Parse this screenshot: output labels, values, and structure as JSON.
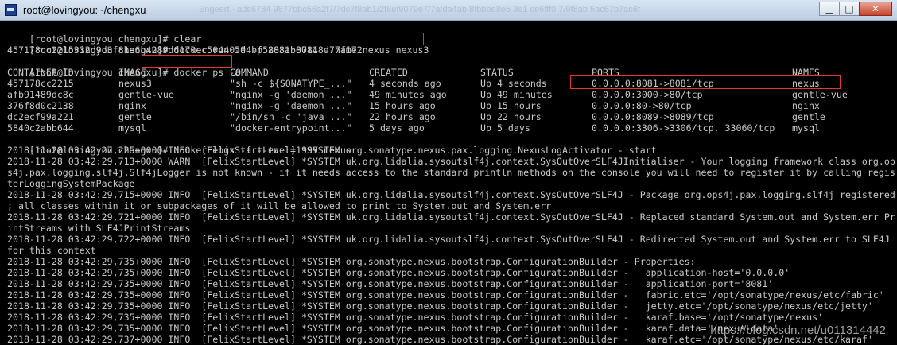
{
  "window": {
    "title": "root@lovingyou:~/chengxu",
    "blurred_text": "Engeert · ads6784 9877bbc56a2f7/7dc7f8ab1/2f8ef9079e7/7a/da4ab 8fbbbe8e5 3e1 ce6fff0 7/9f8ab 5ac67b7ac6f",
    "minimize_symbol": "▁",
    "maximize_symbol": "□",
    "close_symbol": "✕"
  },
  "terminal": {
    "prompt": "[root@lovingyou chengxu]#",
    "cmd_clear": " clear",
    "cmd_run": " docker run -d -p 8081:8081 --name nexus nexus3",
    "run_output": "457178cc2215332d9d3f81a6b4289d6170ec50440594bf5283ab07148d77f172",
    "cmd_ps": " docker ps -a",
    "cmd_logs": " docker logs -f --tail=1999 nexus",
    "ps_table": {
      "headers": [
        "CONTAINER ID",
        "IMAGE",
        "COMMAND",
        "CREATED",
        "STATUS",
        "PORTS",
        "NAMES"
      ],
      "rows": [
        [
          "457178cc2215",
          "nexus3",
          "\"sh -c ${SONATYPE_...\"",
          "4 seconds ago",
          "Up 4 seconds",
          "0.0.0.0:8081->8081/tcp",
          "nexus"
        ],
        [
          "afb91489dc8c",
          "gentle-vue",
          "\"nginx -g 'daemon ...\"",
          "49 minutes ago",
          "Up 49 minutes",
          "0.0.0.0:3000->80/tcp",
          "gentle-vue"
        ],
        [
          "376f8d0c2138",
          "nginx",
          "\"nginx -g 'daemon ...\"",
          "15 hours ago",
          "Up 15 hours",
          "0.0.0.0:80->80/tcp",
          "nginx"
        ],
        [
          "dc2ecf99a221",
          "gentle",
          "\"/bin/sh -c 'java ...\"",
          "22 hours ago",
          "Up 22 hours",
          "0.0.0.0:8089->8089/tcp",
          "gentle"
        ],
        [
          "5840c2abb644",
          "mysql",
          "\"docker-entrypoint...\"",
          "5 days ago",
          "Up 5 days",
          "0.0.0.0:3306->3306/tcp, 33060/tcp",
          "mysql"
        ]
      ]
    },
    "log_lines": [
      "2018-11-28 03:42:27,225+0000 INFO  [FelixStartLevel] *SYSTEM org.sonatype.nexus.pax.logging.NexusLogActivator - start",
      "2018-11-28 03:42:29,713+0000 WARN  [FelixStartLevel] *SYSTEM uk.org.lidalia.sysoutslf4j.context.SysOutOverSLF4JInitialiser - Your logging framework class org.op",
      "s4j.pax.logging.slf4j.Slf4jLogger is not known - if it needs access to the standard println methods on the console you will need to register it by calling regis",
      "terLoggingSystemPackage",
      "2018-11-28 03:42:29,715+0000 INFO  [FelixStartLevel] *SYSTEM uk.org.lidalia.sysoutslf4j.context.SysOutOverSLF4J - Package org.ops4j.pax.logging.slf4j registered",
      "; all classes within it or subpackages of it will be allowed to print to System.out and System.err",
      "2018-11-28 03:42:29,721+0000 INFO  [FelixStartLevel] *SYSTEM uk.org.lidalia.sysoutslf4j.context.SysOutOverSLF4J - Replaced standard System.out and System.err Pr",
      "intStreams with SLF4JPrintStreams",
      "2018-11-28 03:42:29,722+0000 INFO  [FelixStartLevel] *SYSTEM uk.org.lidalia.sysoutslf4j.context.SysOutOverSLF4J - Redirected System.out and System.err to SLF4J",
      "for this context",
      "2018-11-28 03:42:29,735+0000 INFO  [FelixStartLevel] *SYSTEM org.sonatype.nexus.bootstrap.ConfigurationBuilder - Properties:",
      "2018-11-28 03:42:29,735+0000 INFO  [FelixStartLevel] *SYSTEM org.sonatype.nexus.bootstrap.ConfigurationBuilder -   application-host='0.0.0.0'",
      "2018-11-28 03:42:29,735+0000 INFO  [FelixStartLevel] *SYSTEM org.sonatype.nexus.bootstrap.ConfigurationBuilder -   application-port='8081'",
      "2018-11-28 03:42:29,735+0000 INFO  [FelixStartLevel] *SYSTEM org.sonatype.nexus.bootstrap.ConfigurationBuilder -   fabric.etc='/opt/sonatype/nexus/etc/fabric'",
      "2018-11-28 03:42:29,735+0000 INFO  [FelixStartLevel] *SYSTEM org.sonatype.nexus.bootstrap.ConfigurationBuilder -   jetty.etc='/opt/sonatype/nexus/etc/jetty'",
      "2018-11-28 03:42:29,735+0000 INFO  [FelixStartLevel] *SYSTEM org.sonatype.nexus.bootstrap.ConfigurationBuilder -   karaf.base='/opt/sonatype/nexus'",
      "2018-11-28 03:42:29,735+0000 INFO  [FelixStartLevel] *SYSTEM org.sonatype.nexus.bootstrap.ConfigurationBuilder -   karaf.data='/nexus-data'",
      "2018-11-28 03:42:29,737+0000 INFO  [FelixStartLevel] *SYSTEM org.sonatype.nexus.bootstrap.ConfigurationBuilder -   karaf.etc='/opt/sonatype/nexus/etc/karaf'"
    ]
  },
  "watermark": "https://blog.csdn.net/u011314442",
  "colors": {
    "terminal_bg": "#000000",
    "terminal_fg": "#c8c8c8",
    "highlight_box": "#e03a2c"
  }
}
